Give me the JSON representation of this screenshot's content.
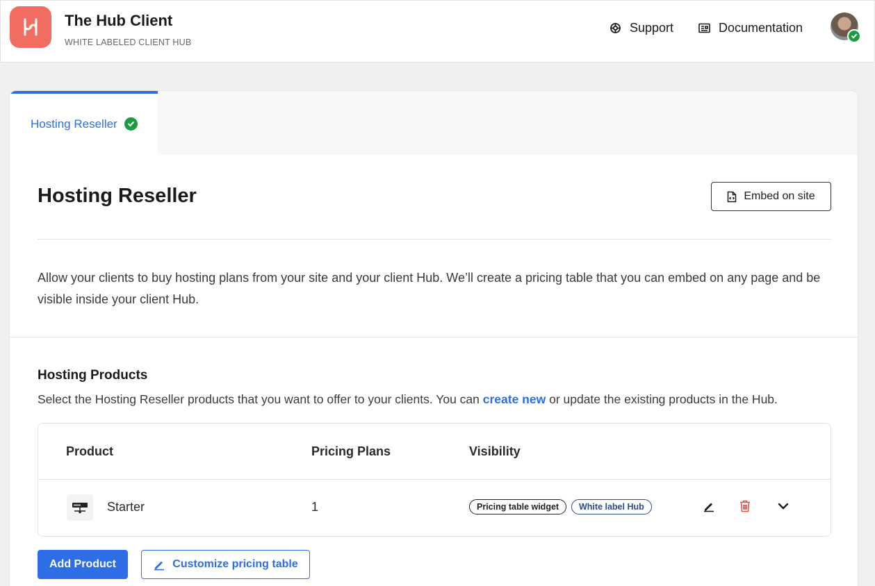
{
  "header": {
    "app_title": "The Hub Client",
    "app_subtitle": "WHITE LABELED CLIENT HUB",
    "logo_icon": "hub-logo-icon",
    "nav": [
      {
        "label": "Support",
        "icon": "lifebuoy-icon"
      },
      {
        "label": "Documentation",
        "icon": "document-icon"
      }
    ],
    "avatar_status": "online",
    "brand_color": "#f26d61"
  },
  "tabs": [
    {
      "label": "Hosting Reseller",
      "active": true,
      "status": "complete"
    }
  ],
  "main": {
    "title": "Hosting Reseller",
    "embed_label": "Embed on site",
    "description": "Allow your clients to buy hosting plans from your site and your client Hub. We’ll create a pricing table that you can embed on any page and be visible inside your client Hub.",
    "section_title": "Hosting Products",
    "section_desc_before": "Select the Hosting Reseller products that you want to offer to your clients. You can ",
    "section_desc_link": "create new",
    "section_desc_after": " or update the existing products in the Hub."
  },
  "table": {
    "columns": [
      "Product",
      "Pricing Plans",
      "Visibility"
    ],
    "rows": [
      {
        "name": "Starter",
        "plans": "1",
        "visibility": [
          "Pricing table widget",
          "White label Hub"
        ]
      }
    ]
  },
  "actions": {
    "add_label": "Add Product",
    "customize_label": "Customize pricing table"
  },
  "colors": {
    "accent": "#2d6ee6",
    "success": "#1a9d3d",
    "danger": "#e0524a"
  }
}
